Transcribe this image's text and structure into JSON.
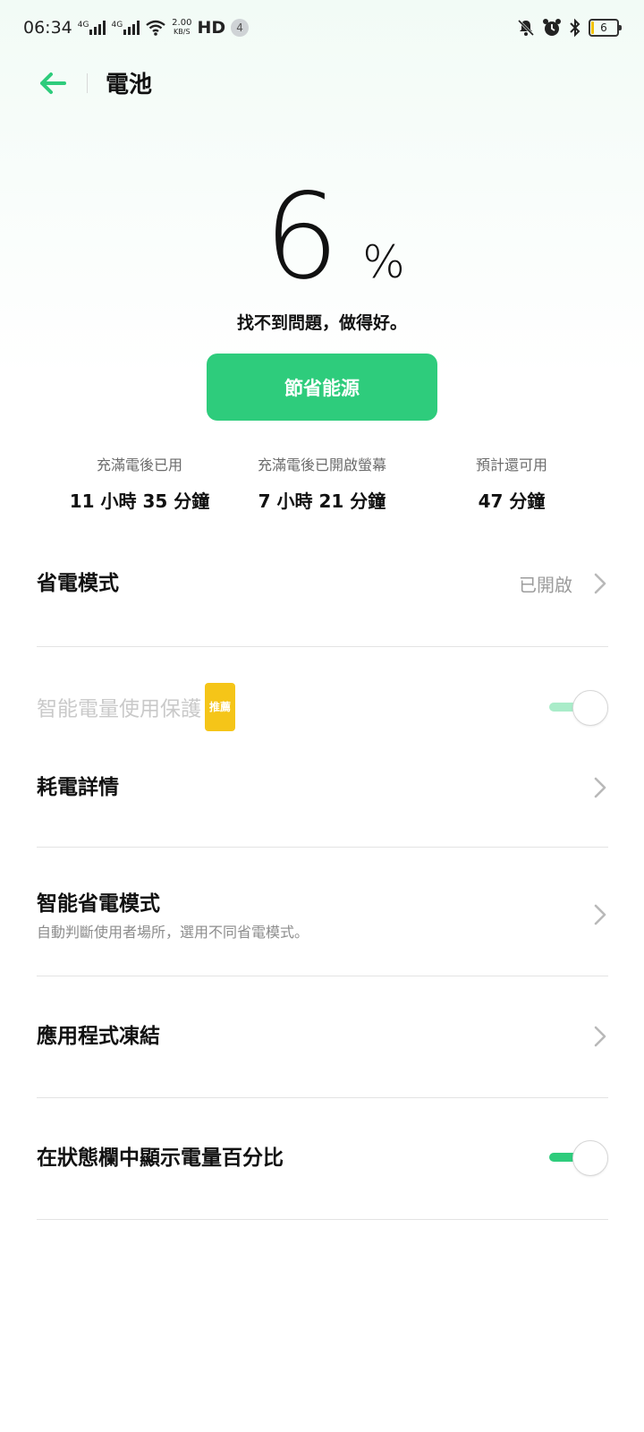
{
  "status_bar": {
    "time": "06:34",
    "net1": "4G",
    "net2": "4G",
    "speed_value": "2.00",
    "speed_unit": "KB/S",
    "hd": "HD",
    "notif_count": "4",
    "battery_level": "6"
  },
  "header": {
    "title": "電池"
  },
  "battery": {
    "percent": "6",
    "percent_sign": "%",
    "message": "找不到問題，做得好。",
    "save_button_label": "節省能源"
  },
  "stats": [
    {
      "label": "充滿電後已用",
      "value": "11 小時 35 分鐘"
    },
    {
      "label": "充滿電後已開啟螢幕",
      "value": "7 小時 21 分鐘"
    },
    {
      "label": "預計還可用",
      "value": "47 分鐘"
    }
  ],
  "settings": {
    "power_saving_mode": {
      "label": "省電模式",
      "value": "已開啟"
    },
    "smart_protection": {
      "label": "智能電量使用保護",
      "badge": "推薦",
      "enabled": true
    },
    "consumption_details": {
      "label": "耗電詳情"
    },
    "smart_power_saving": {
      "label": "智能省電模式",
      "subtitle": "自動判斷使用者場所，選用不同省電模式。"
    },
    "app_freeze": {
      "label": "應用程式凍結"
    },
    "show_percentage": {
      "label": "在狀態欄中顯示電量百分比",
      "enabled": true
    }
  },
  "colors": {
    "accent": "#2ecc7c",
    "badge": "#f5c518",
    "battery_low": "#f2c200"
  }
}
